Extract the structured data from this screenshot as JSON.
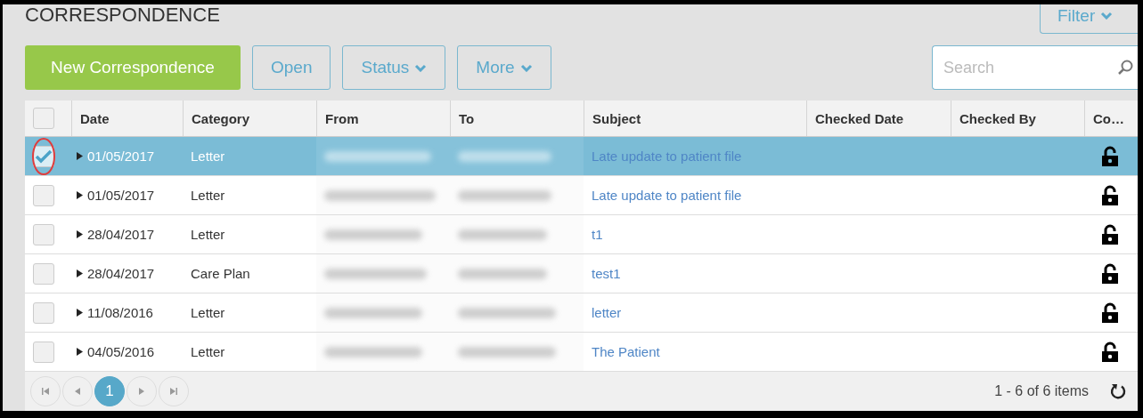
{
  "title": "CORRESPONDENCE",
  "filter_button": {
    "label": "Filter"
  },
  "toolbar": [
    {
      "label": "New Correspondence",
      "kind": "primary"
    },
    {
      "label": "Open",
      "kind": "plain"
    },
    {
      "label": "Status",
      "kind": "dropdown"
    },
    {
      "label": "More",
      "kind": "dropdown"
    }
  ],
  "search": {
    "placeholder": "Search"
  },
  "table": {
    "select_all": {
      "checked": false
    },
    "columns": [
      "Date",
      "Category",
      "From",
      "To",
      "Subject",
      "Checked Date",
      "Checked By",
      "Co…"
    ],
    "rows": [
      {
        "selected": true,
        "checked": true,
        "expanded": false,
        "date": "01/05/2017",
        "category": "Letter",
        "subject": "Late update to patient file",
        "locked": false
      },
      {
        "selected": false,
        "checked": false,
        "expanded": false,
        "date": "01/05/2017",
        "category": "Letter",
        "subject": "Late update to patient file",
        "locked": false
      },
      {
        "selected": false,
        "checked": false,
        "expanded": false,
        "date": "28/04/2017",
        "category": "Letter",
        "subject": "t1",
        "locked": false
      },
      {
        "selected": false,
        "checked": false,
        "expanded": false,
        "date": "28/04/2017",
        "category": "Care Plan",
        "subject": "test1",
        "locked": false
      },
      {
        "selected": false,
        "checked": false,
        "expanded": false,
        "date": "11/08/2016",
        "category": "Letter",
        "subject": "letter",
        "locked": false
      },
      {
        "selected": false,
        "checked": false,
        "expanded": false,
        "date": "04/05/2016",
        "category": "Letter",
        "subject": "The Patient",
        "locked": false
      }
    ]
  },
  "pager": {
    "pages": [
      {
        "label": "1",
        "selected": true
      }
    ],
    "summary": "1 - 6 of 6 items"
  }
}
